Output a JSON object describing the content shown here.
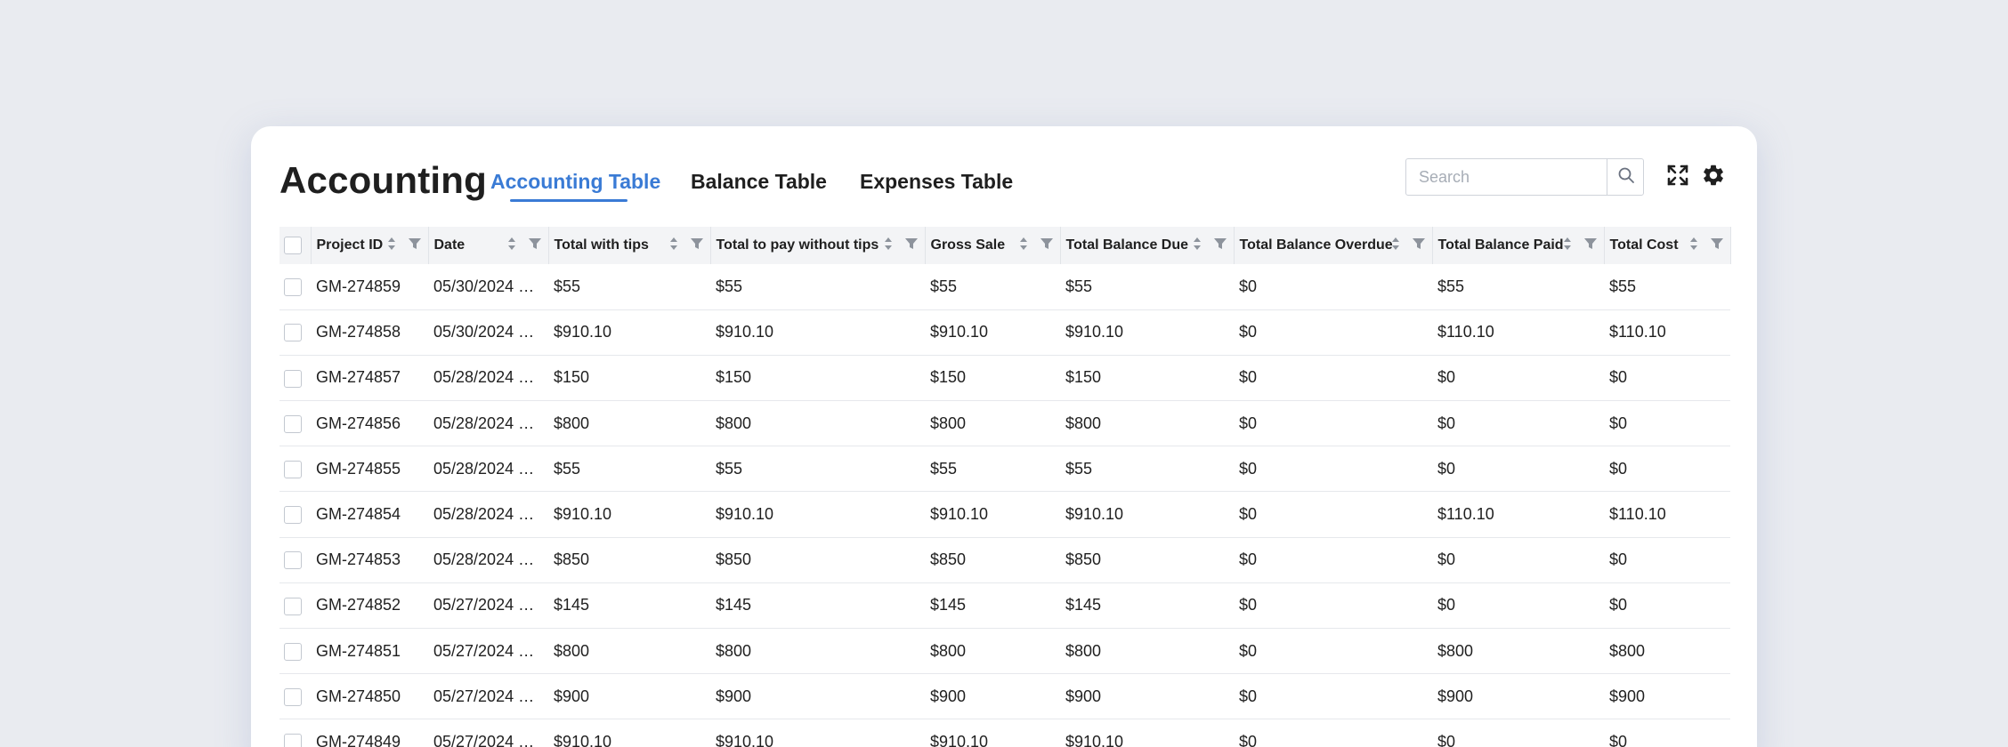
{
  "header": {
    "title": "Accounting",
    "tabs": [
      {
        "label": "Accounting Table",
        "active": true
      },
      {
        "label": "Balance Table",
        "active": false
      },
      {
        "label": "Expenses Table",
        "active": false
      }
    ],
    "search_placeholder": "Search",
    "search_icon": "search-icon",
    "expand_icon": "fullscreen-icon",
    "settings_icon": "gear-icon",
    "accent_color": "#3a7bd5"
  },
  "table": {
    "columns": [
      "Project ID",
      "Date",
      "Total with tips",
      "Total to pay without tips",
      "Gross Sale",
      "Total Balance Due",
      "Total Balance Overdue",
      "Total Balance Paid",
      "Total Cost"
    ],
    "rows": [
      [
        "GM-274859",
        "05/30/2024 …",
        "$55",
        "$55",
        "$55",
        "$55",
        "$0",
        "$55",
        "$55"
      ],
      [
        "GM-274858",
        "05/30/2024 …",
        "$910.10",
        "$910.10",
        "$910.10",
        "$910.10",
        "$0",
        "$110.10",
        "$110.10"
      ],
      [
        "GM-274857",
        "05/28/2024 …",
        "$150",
        "$150",
        "$150",
        "$150",
        "$0",
        "$0",
        "$0"
      ],
      [
        "GM-274856",
        "05/28/2024 …",
        "$800",
        "$800",
        "$800",
        "$800",
        "$0",
        "$0",
        "$0"
      ],
      [
        "GM-274855",
        "05/28/2024 …",
        "$55",
        "$55",
        "$55",
        "$55",
        "$0",
        "$0",
        "$0"
      ],
      [
        "GM-274854",
        "05/28/2024 …",
        "$910.10",
        "$910.10",
        "$910.10",
        "$910.10",
        "$0",
        "$110.10",
        "$110.10"
      ],
      [
        "GM-274853",
        "05/28/2024 …",
        "$850",
        "$850",
        "$850",
        "$850",
        "$0",
        "$0",
        "$0"
      ],
      [
        "GM-274852",
        "05/27/2024 …",
        "$145",
        "$145",
        "$145",
        "$145",
        "$0",
        "$0",
        "$0"
      ],
      [
        "GM-274851",
        "05/27/2024 …",
        "$800",
        "$800",
        "$800",
        "$800",
        "$0",
        "$800",
        "$800"
      ],
      [
        "GM-274850",
        "05/27/2024 …",
        "$900",
        "$900",
        "$900",
        "$900",
        "$0",
        "$900",
        "$900"
      ],
      [
        "GM-274849",
        "05/27/2024 …",
        "$910.10",
        "$910.10",
        "$910.10",
        "$910.10",
        "$0",
        "$0",
        "$0"
      ]
    ]
  }
}
